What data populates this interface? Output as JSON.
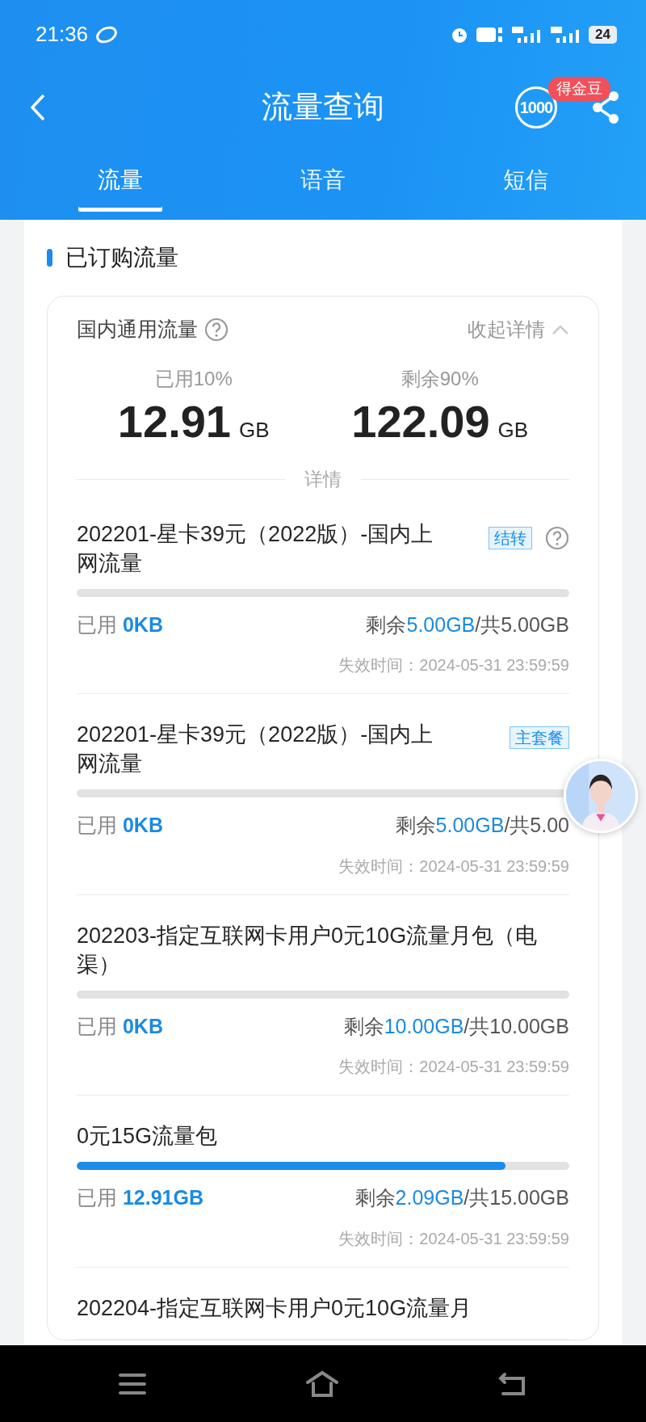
{
  "status_bar": {
    "time": "21:36",
    "battery": "24"
  },
  "header": {
    "title": "流量查询",
    "service_logo": "1000",
    "badge": "得金豆"
  },
  "tabs": [
    {
      "label": "流量",
      "selected": true
    },
    {
      "label": "语音",
      "selected": false
    },
    {
      "label": "短信",
      "selected": false
    }
  ],
  "section_title": "已订购流量",
  "summary": {
    "name": "国内通用流量",
    "toggle": "收起详情",
    "used_label": "已用10%",
    "used_value": "12.91",
    "used_unit": "GB",
    "remain_label": "剩余90%",
    "remain_value": "122.09",
    "remain_unit": "GB",
    "details_label": "详情"
  },
  "items": [
    {
      "title": "202201-星卡39元（2022版）-国内上网流量",
      "tag": "结转",
      "help": true,
      "level": 0,
      "used_label": "已用",
      "used": "0KB",
      "remain_label": "剩余",
      "remain": "5.00GB",
      "total": "/共5.00GB",
      "expiry": "失效时间：2024-05-31 23:59:59"
    },
    {
      "title": "202201-星卡39元（2022版）-国内上网流量",
      "tag": "主套餐",
      "help": false,
      "level": 0,
      "used_label": "已用",
      "used": "0KB",
      "remain_label": "剩余",
      "remain": "5.00GB",
      "total": "/共5.00",
      "expiry": "失效时间：2024-05-31 23:59:59"
    },
    {
      "title": "202203-指定互联网卡用户0元10G流量月包（电渠）",
      "help": false,
      "level": 0,
      "used_label": "已用",
      "used": "0KB",
      "remain_label": "剩余",
      "remain": "10.00GB",
      "total": "/共10.00GB",
      "expiry": "失效时间：2024-05-31 23:59:59"
    },
    {
      "title": "0元15G流量包",
      "help": false,
      "level": 0.87,
      "used_label": "已用",
      "used": "12.91GB",
      "remain_label": "剩余",
      "remain": "2.09GB",
      "total": "/共15.00GB",
      "expiry": "失效时间：2024-05-31 23:59:59"
    },
    {
      "title": "202204-指定互联网卡用户0元10G流量月",
      "help": false
    }
  ]
}
